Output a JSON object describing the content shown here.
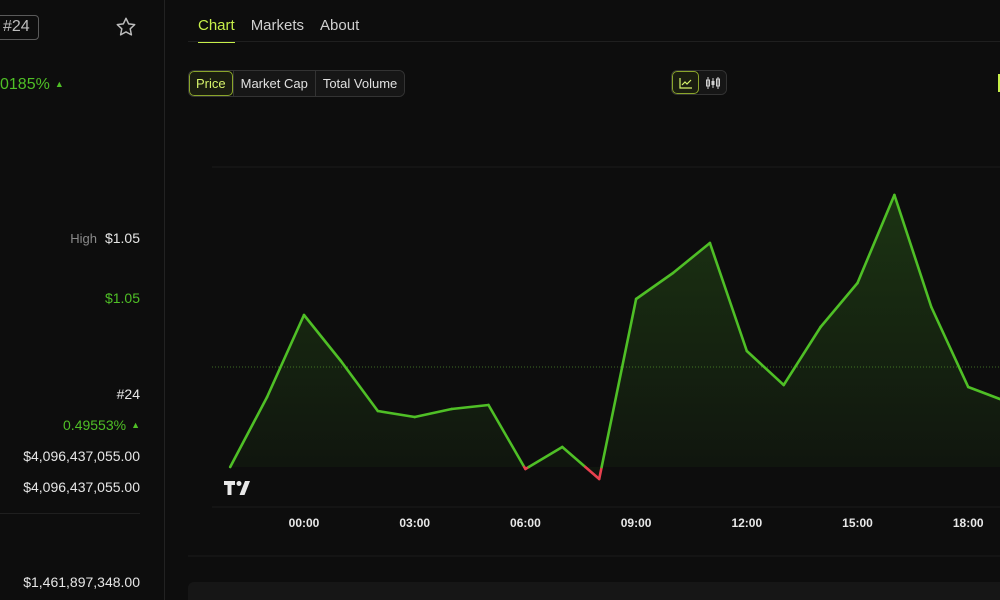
{
  "coin": {
    "rank_badge": "#24",
    "price_change_pct": "0185%",
    "high_label": "High",
    "high_value": "$1.05",
    "current_price": "$1.05",
    "rank": "#24",
    "change_24h": "0.49553%",
    "market_cap": "$4,096,437,055.00",
    "fdv": "$4,096,437,055.00",
    "volume": "$1,461,897,348.00"
  },
  "tabs": [
    {
      "label": "Chart",
      "active": true
    },
    {
      "label": "Markets",
      "active": false
    },
    {
      "label": "About",
      "active": false
    }
  ],
  "metric_selector": [
    {
      "label": "Price",
      "active": true
    },
    {
      "label": "Market Cap",
      "active": false
    },
    {
      "label": "Total Volume",
      "active": false
    }
  ],
  "chart_view_toggle": [
    {
      "icon": "line-chart-icon",
      "active": true
    },
    {
      "icon": "candlestick-icon",
      "active": false
    }
  ],
  "colors": {
    "accent": "#c7ef4a",
    "up": "#4fbf26",
    "down": "#e8414f"
  },
  "chart_data": {
    "type": "line",
    "x_ticks": [
      "00:00",
      "03:00",
      "06:00",
      "09:00",
      "12:00",
      "15:00",
      "18:00"
    ],
    "x_hours": [
      -2,
      -1,
      0,
      1,
      2,
      3,
      4,
      5,
      6,
      7,
      8,
      9,
      10,
      11,
      12,
      13,
      14,
      15,
      16,
      17,
      18,
      19
    ],
    "values": [
      1.0,
      1.035,
      1.076,
      1.053,
      1.028,
      1.025,
      1.029,
      1.031,
      0.999,
      1.01,
      0.994,
      1.084,
      1.097,
      1.112,
      1.058,
      1.041,
      1.07,
      1.092,
      1.136,
      1.08,
      1.04,
      1.033
    ],
    "baseline": 1.0,
    "reference_line": 1.05,
    "ylim": [
      0.98,
      1.15
    ],
    "grid": false
  },
  "watermark": "tradingview-logo"
}
